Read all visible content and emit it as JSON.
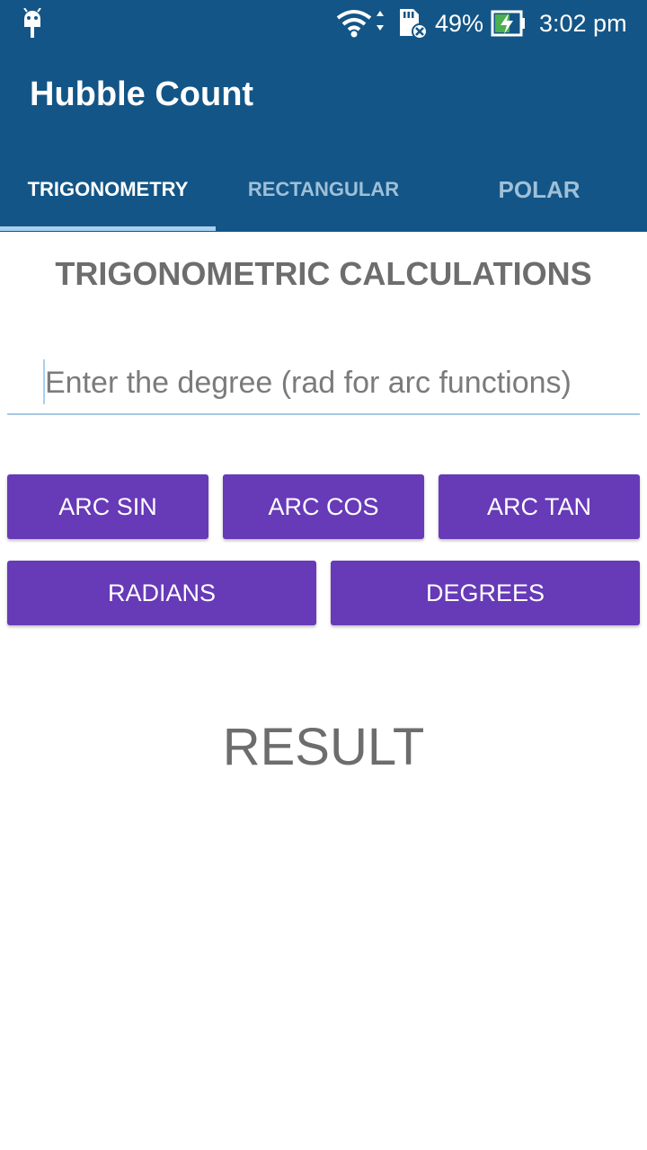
{
  "status_bar": {
    "battery": "49%",
    "time": "3:02 pm",
    "icons": [
      "android-icon",
      "wifi-icon",
      "sd-card-icon",
      "battery-charging-icon"
    ]
  },
  "app_bar": {
    "title": "Hubble Count"
  },
  "tabs": [
    {
      "label": "TRIGONOMETRY",
      "selected": true
    },
    {
      "label": "RECTANGULAR",
      "selected": false
    },
    {
      "label": "POLAR",
      "selected": false
    }
  ],
  "main": {
    "heading": "TRIGONOMETRIC CALCULATIONS",
    "input": {
      "placeholder": "Enter the degree (rad for arc functions)",
      "value": ""
    },
    "buttons_row1": [
      "ARC SIN",
      "ARC COS",
      "ARC TAN"
    ],
    "buttons_row2": [
      "RADIANS",
      "DEGREES"
    ],
    "result": "RESULT"
  },
  "colors": {
    "primary": "#135586",
    "accent": "#673ab7",
    "tab_indicator": "#a9d0ef",
    "text_gray": "#6d6d6d"
  }
}
